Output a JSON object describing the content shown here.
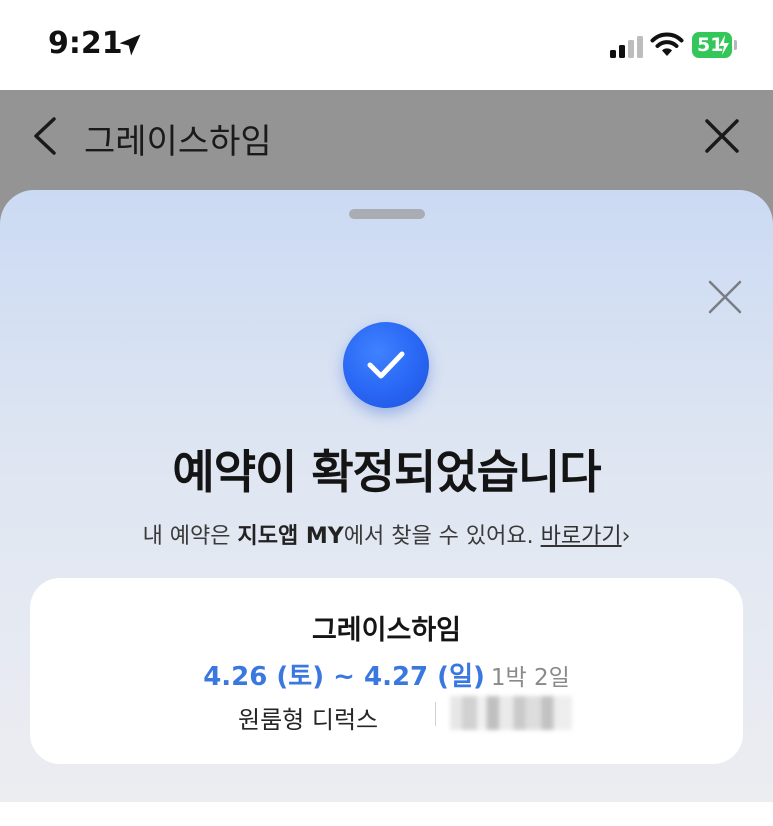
{
  "status_bar": {
    "time": "9:21",
    "battery_level": "51",
    "battery_color": "#33c759"
  },
  "header": {
    "title": "그레이스하임",
    "back_icon": "chevron-left-icon",
    "close_icon": "close-icon"
  },
  "sheet": {
    "close_icon": "close-icon",
    "check_icon": "check-circle-icon",
    "accent_color": "#2866f4",
    "title": "예약이 확정되었습니다",
    "subtitle_prefix": "내 예약은 ",
    "subtitle_bold": "지도앱 MY",
    "subtitle_suffix": "에서 찾을 수 있어요.",
    "link_label": "바로가기",
    "link_chevron": "›"
  },
  "booking_card": {
    "name": "그레이스하임",
    "dates": "4.26 (토) ~ 4.27 (일)",
    "nights": "1박 2일",
    "room_type": "원룸형 디럭스",
    "date_color": "#3a78e0"
  }
}
